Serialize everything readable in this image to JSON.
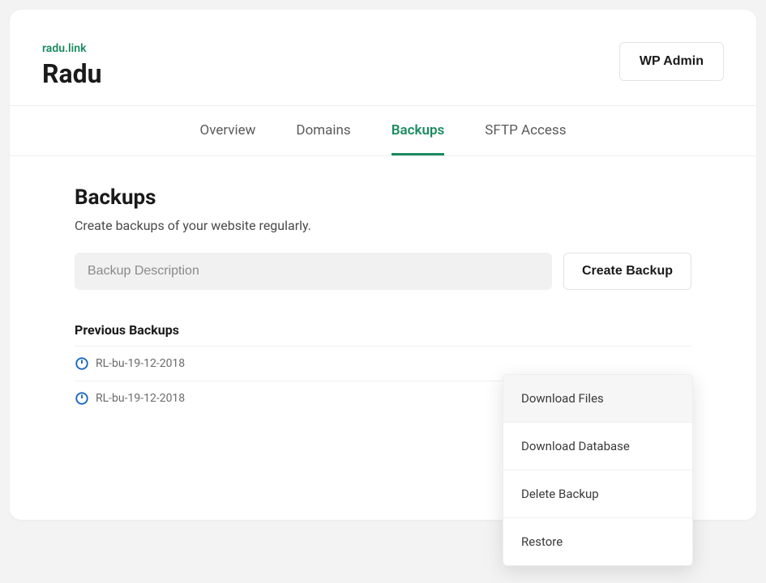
{
  "header": {
    "domain": "radu.link",
    "site_title": "Radu",
    "wp_admin_label": "WP Admin"
  },
  "tabs": [
    {
      "label": "Overview",
      "active": false
    },
    {
      "label": "Domains",
      "active": false
    },
    {
      "label": "Backups",
      "active": true
    },
    {
      "label": "SFTP Access",
      "active": false
    }
  ],
  "backups": {
    "title": "Backups",
    "subtitle": "Create backups of your website regularly.",
    "input_placeholder": "Backup Description",
    "create_label": "Create Backup",
    "previous_title": "Previous Backups",
    "items": [
      {
        "name": "RL-bu-19-12-2018"
      },
      {
        "name": "RL-bu-19-12-2018"
      }
    ]
  },
  "dropdown": {
    "items": [
      {
        "label": "Download Files",
        "hover": true
      },
      {
        "label": "Download Database",
        "hover": false
      },
      {
        "label": "Delete Backup",
        "hover": false
      },
      {
        "label": "Restore",
        "hover": false
      }
    ]
  },
  "colors": {
    "accent": "#1a8b5f",
    "icon_blue": "#1565c0"
  }
}
